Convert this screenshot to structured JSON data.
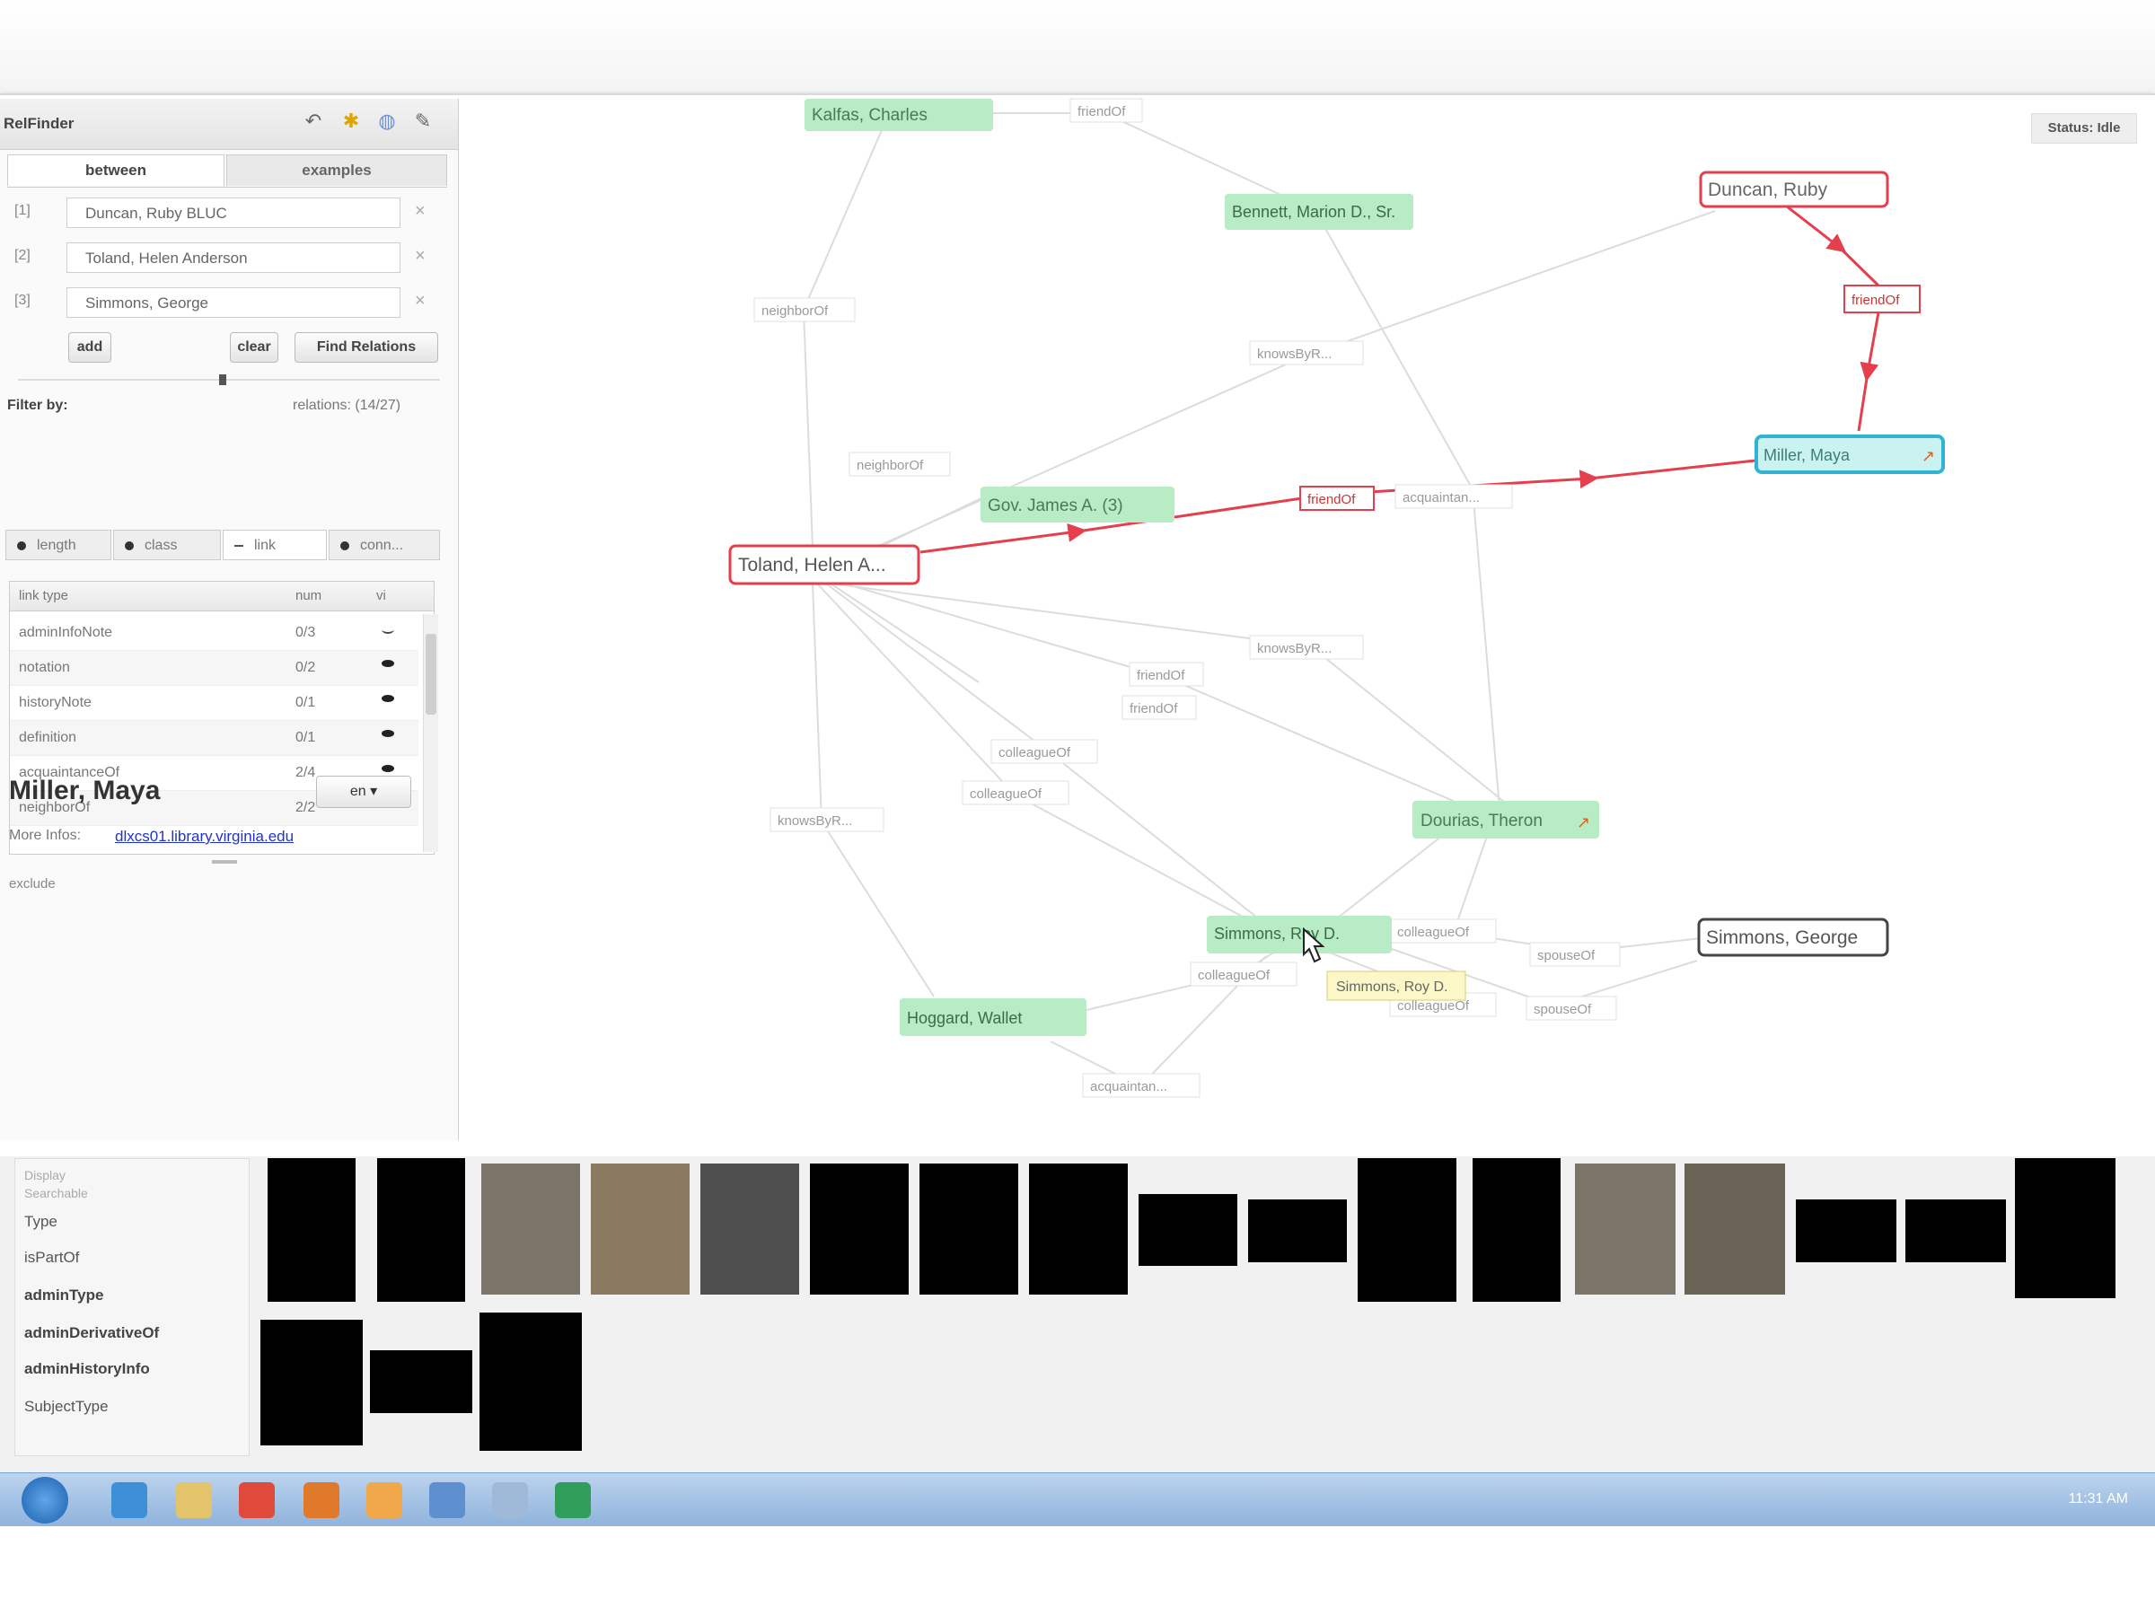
{
  "app": {
    "title": "RelFinder",
    "tabs": [
      "between",
      "examples"
    ],
    "toolbar_icons": [
      "undo-icon",
      "clean-icon",
      "globe-icon",
      "settings-icon"
    ]
  },
  "search": {
    "slots": [
      {
        "index": "[1]",
        "value": "Duncan, Ruby BLUC"
      },
      {
        "index": "[2]",
        "value": "Toland, Helen Anderson"
      },
      {
        "index": "[3]",
        "value": "Simmons, George"
      }
    ],
    "add_label": "add",
    "clear_label": "clear",
    "find_label": "Find Relations"
  },
  "filter": {
    "label": "Filter by:",
    "relations": "relations: (14/27)",
    "pills": [
      "length",
      "class",
      "link",
      "conn..."
    ],
    "columns": [
      "link type",
      "num",
      "vi"
    ],
    "rows": [
      {
        "type": "adminInfoNote",
        "num": "0/3"
      },
      {
        "type": "notation",
        "num": "0/2"
      },
      {
        "type": "historyNote",
        "num": "0/1"
      },
      {
        "type": "definition",
        "num": "0/1"
      },
      {
        "type": "acquaintanceOf",
        "num": "2/4"
      },
      {
        "type": "neighborOf",
        "num": "2/2"
      }
    ]
  },
  "detail": {
    "title": "Miller, Maya",
    "selector": "en",
    "more_info_label": "More Infos:",
    "more_info_link": "dlxcs01.library.virginia.edu",
    "note": "exclude"
  },
  "graph": {
    "status": "Status: Idle",
    "nodes": [
      {
        "id": "kalfas",
        "label": "Kalfas, Charles",
        "kind": "green"
      },
      {
        "id": "bennett",
        "label": "Bennett, Marion D., Sr.",
        "kind": "green"
      },
      {
        "id": "duncan",
        "label": "Duncan, Ruby",
        "kind": "red"
      },
      {
        "id": "miller",
        "label": "Miller, Maya",
        "kind": "cyan"
      },
      {
        "id": "gov",
        "label": "Gov. James A. (3)",
        "kind": "green"
      },
      {
        "id": "toland",
        "label": "Toland, Helen A...",
        "kind": "red"
      },
      {
        "id": "dourias",
        "label": "Dourias, Theron",
        "kind": "green"
      },
      {
        "id": "simmonsr",
        "label": "Simmons, Roy D.",
        "kind": "green"
      },
      {
        "id": "simmonsg",
        "label": "Simmons, George",
        "kind": "black"
      },
      {
        "id": "hoggard",
        "label": "Hoggard, Wallet",
        "kind": "green"
      }
    ],
    "edge_labels": [
      "friendOf",
      "neighborOf",
      "knowsByR...",
      "neighborOf",
      "friendOf",
      "acquaintan...",
      "knowsByR...",
      "friendOf",
      "friendOf",
      "colleagueOf",
      "colleagueOf",
      "knowsByR...",
      "colleagueOf",
      "colleagueOf",
      "spouseOf",
      "colleagueOf",
      "spouseOf",
      "acquaintan...",
      "friendOf"
    ],
    "tooltip": "Simmons, Roy D."
  },
  "facets": {
    "items": [
      "Display",
      "Searchable",
      "Type",
      "isPartOf",
      "adminType",
      "adminDerivativeOf",
      "adminHistoryInfo",
      "SubjectType"
    ]
  },
  "taskbar": {
    "clock": "11:31 AM"
  },
  "colors": {
    "path": "#e53e4d",
    "node_green": "#b7ecc4",
    "node_cyan": "#c9f2f0",
    "edge_grey": "#d6d6d6"
  }
}
